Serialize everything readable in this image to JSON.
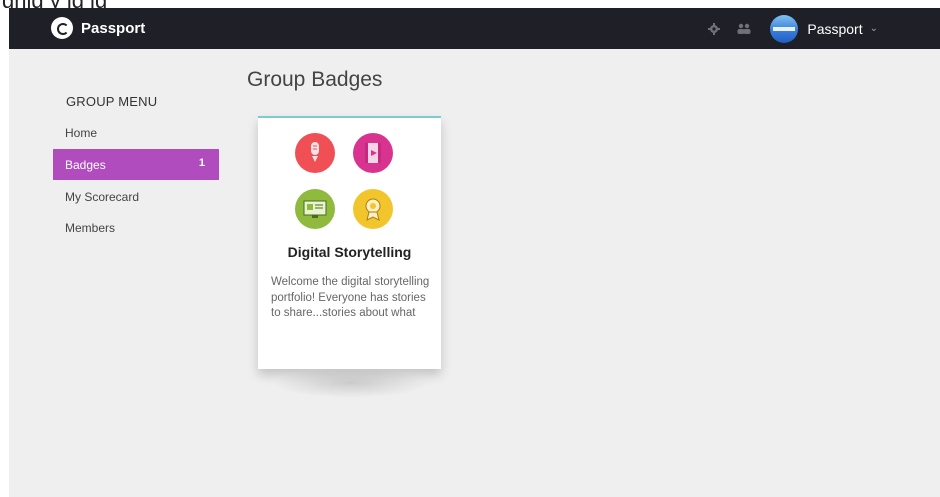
{
  "overlay_caption": "ghig y ig ig",
  "navbar": {
    "brand": "Passport",
    "icons": [
      "settings-icon",
      "group-icon"
    ],
    "user_name": "Passport",
    "chevron": "⌄"
  },
  "sidebar": {
    "title": "GROUP MENU",
    "items": [
      {
        "label": "Home",
        "active": false
      },
      {
        "label": "Badges",
        "active": true,
        "count": "1"
      },
      {
        "label": "My Scorecard",
        "active": false
      },
      {
        "label": "Members",
        "active": false
      }
    ]
  },
  "main": {
    "title": "Group Badges",
    "cards": [
      {
        "title": "Digital Storytelling",
        "description": "Welcome the digital storytelling portfolio! Everyone has stories to share...stories about what",
        "icons": [
          "microphone-icon",
          "film-icon",
          "computer-icon",
          "award-icon"
        ]
      }
    ]
  },
  "colors": {
    "navbar": "#1f1f28",
    "active_menu": "#b04cbe",
    "card_accent": "#79cdd0",
    "badge_red": "#ef4f55",
    "badge_pink": "#d8348f",
    "badge_green": "#8fba3e",
    "badge_yellow": "#f3c52c"
  }
}
